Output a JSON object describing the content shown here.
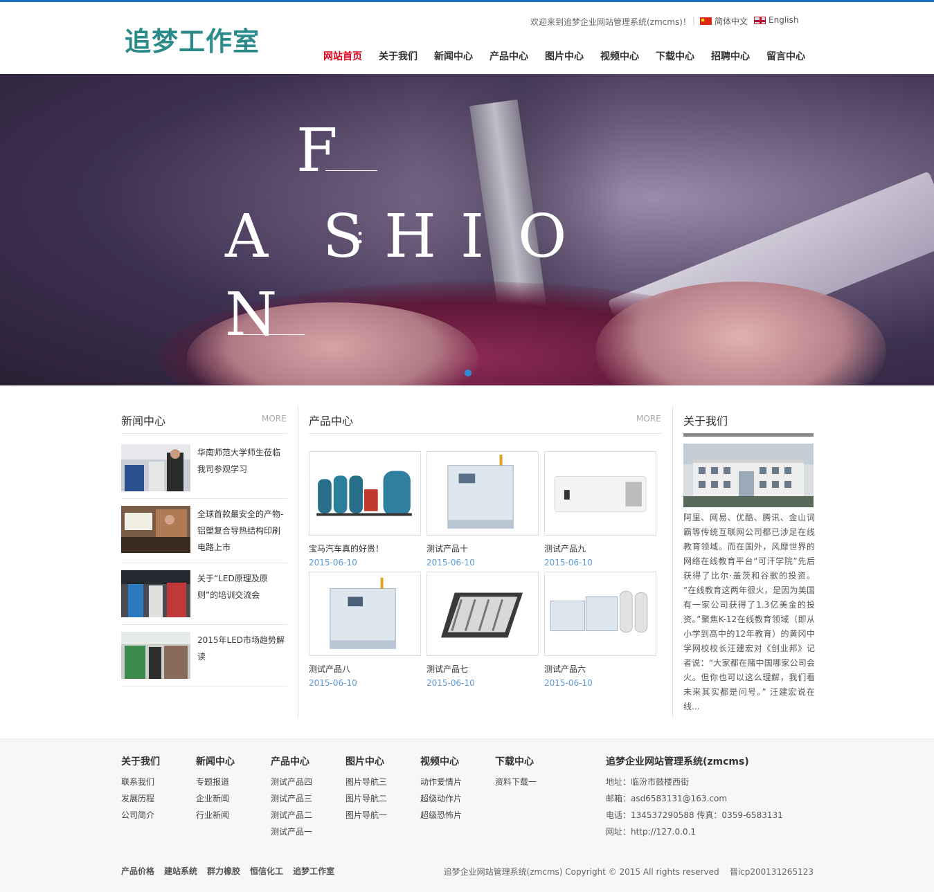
{
  "header": {
    "logo": "追梦工作室",
    "welcome": "欢迎来到追梦企业网站管理系统(zmcms)！",
    "separator": "|",
    "lang_cn": "简体中文",
    "lang_en": "English"
  },
  "nav": [
    {
      "label": "网站首页",
      "active": true
    },
    {
      "label": "关于我们"
    },
    {
      "label": "新闻中心"
    },
    {
      "label": "产品中心"
    },
    {
      "label": "图片中心"
    },
    {
      "label": "视频中心"
    },
    {
      "label": "下载中心"
    },
    {
      "label": "招聘中心"
    },
    {
      "label": "留言中心"
    }
  ],
  "banner": {
    "letters": [
      "F",
      "A",
      "S",
      ":",
      "H",
      "I",
      "O",
      "N"
    ],
    "slide_count": 1
  },
  "news": {
    "title": "新闻中心",
    "more": "MORE",
    "items": [
      {
        "title": "华南师范大学师生莅临我司参观学习"
      },
      {
        "title": "全球首款最安全的产物-铝塑复合导热结构印刷电路上市"
      },
      {
        "title": "关于“LED原理及原则”的培训交流会"
      },
      {
        "title": "2015年LED市场趋势解读"
      }
    ]
  },
  "products": {
    "title": "产品中心",
    "more": "MORE",
    "items": [
      {
        "name": "宝马汽车真的好贵！",
        "date": "2015-06-10"
      },
      {
        "name": "测试产品十",
        "date": "2015-06-10"
      },
      {
        "name": "测试产品九",
        "date": "2015-06-10"
      },
      {
        "name": "测试产品八",
        "date": "2015-06-10"
      },
      {
        "name": "测试产品七",
        "date": "2015-06-10"
      },
      {
        "name": "测试产品六",
        "date": "2015-06-10"
      }
    ]
  },
  "about": {
    "title": "关于我们",
    "text": "阿里、网易、优酷、腾讯、金山词霸等传统互联网公司都已涉足在线教育领域。而在国外，风靡世界的网络在线教育平台“可汗学院”先后获得了比尔·盖茨和谷歌的投资。 “在线教育这两年很火，是因为美国有一家公司获得了1.3亿美金的投资。”聚焦K-12在线教育领域（即从小学到高中的12年教育）的黄冈中学网校校长汪建宏对《创业邦》记者说：“大家都在赌中国哪家公司会火。但你也可以这么理解，我们看未来其实都是问号。” 汪建宏说在线..."
  },
  "footer": {
    "columns": [
      {
        "title": "关于我们",
        "links": [
          "联系我们",
          "发展历程",
          "公司简介"
        ]
      },
      {
        "title": "新闻中心",
        "links": [
          "专题报道",
          "企业新闻",
          "行业新闻"
        ]
      },
      {
        "title": "产品中心",
        "links": [
          "测试产品四",
          "测试产品三",
          "测试产品二",
          "测试产品一"
        ]
      },
      {
        "title": "图片中心",
        "links": [
          "图片导航三",
          "图片导航二",
          "图片导航一"
        ]
      },
      {
        "title": "视频中心",
        "links": [
          "动作爱情片",
          "超级动作片",
          "超级恐怖片"
        ]
      },
      {
        "title": "下载中心",
        "links": [
          "资料下载一"
        ]
      }
    ],
    "contact": {
      "title": "追梦企业网站管理系统(zmcms)",
      "lines": [
        "地址：临汾市鼓楼西街",
        "邮箱：asd6583131@163.com",
        "电话：134537290588 传真：0359-6583131",
        "网址：http://127.0.0.1"
      ]
    },
    "friend_links": [
      "产品价格",
      "建站系统",
      "群力橡胶",
      "恒信化工",
      "追梦工作室"
    ],
    "copyright": "追梦企业网站管理系统(zmcms) Copyright © 2015 All rights reserved    晋icp200131265123"
  }
}
